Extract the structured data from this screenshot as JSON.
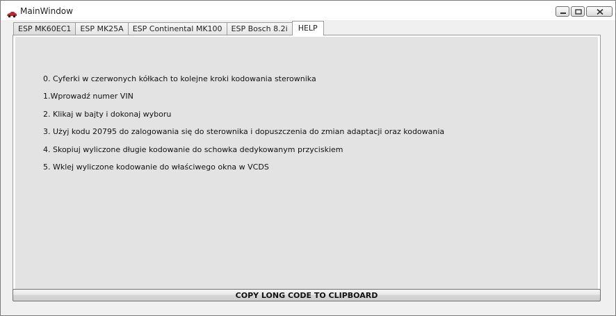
{
  "window": {
    "title": "MainWindow",
    "icon": "car-icon",
    "controls": [
      "minimize-icon",
      "maximize-icon",
      "close-icon"
    ]
  },
  "tabs": [
    {
      "label": "ESP MK60EC1",
      "selected": false
    },
    {
      "label": "ESP MK25A",
      "selected": false
    },
    {
      "label": "ESP Continental MK100",
      "selected": false
    },
    {
      "label": "ESP Bosch 8.2i",
      "selected": false
    },
    {
      "label": "HELP",
      "selected": true
    }
  ],
  "help": {
    "lines": [
      "0. Cyferki w czerwonych kółkach to kolejne kroki kodowania sterownika",
      "1.Wprowadź numer VIN",
      "2. Klikaj w bajty i dokonaj wyboru",
      "3. Użyj kodu 20795 do zalogowania się do sterownika i dopuszczenia do zmian adaptacji oraz kodowania",
      "4. Skopiuj wyliczone długie kodowanie do schowka dedykowanym przyciskiem",
      "5. Wklej wyliczone kodowanie do właściwego okna w VCDS"
    ]
  },
  "copy_button": {
    "label": "COPY LONG CODE TO CLIPBOARD"
  },
  "colors": {
    "accent_icon": "#c0282d",
    "panel_bg": "#e3e3e3",
    "window_bg": "#f0f0f0"
  }
}
